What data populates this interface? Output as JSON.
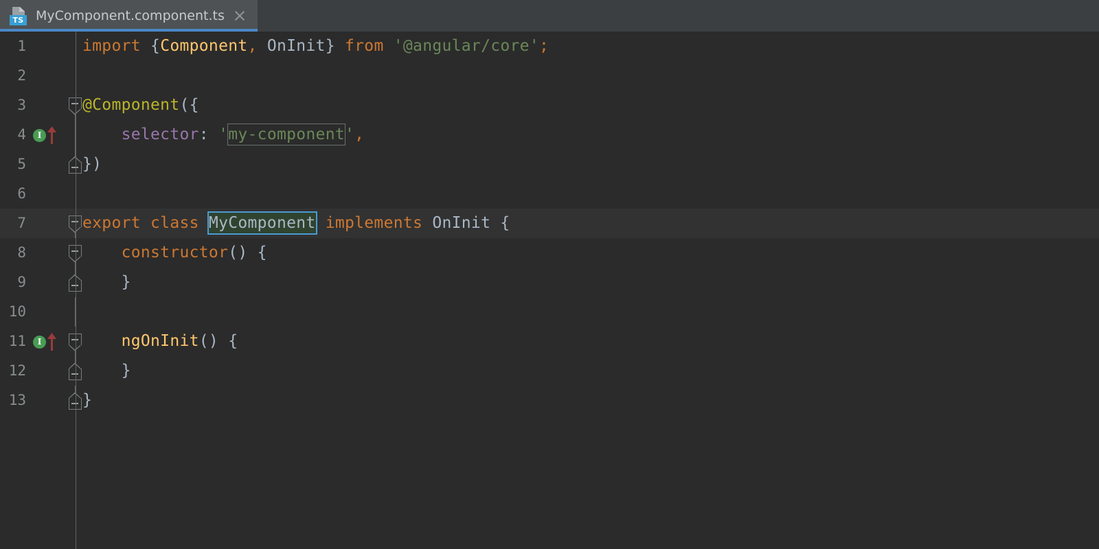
{
  "window": {
    "title": "MyComponent.component.ts"
  },
  "tab_bar": {
    "tabs": [
      {
        "label": "MyComponent.component.ts",
        "file_icon": "typescript-file-icon",
        "badge_text": "TS",
        "close_icon": "close-icon",
        "active": true
      }
    ]
  },
  "editor": {
    "language": "TypeScript",
    "current_line": 7,
    "gutter_markers": [
      {
        "line": 4,
        "icon": "implemented-method-icon",
        "glyph": "I",
        "color": "#499c54",
        "arrow": "overriding-arrow-icon",
        "arrow_color": "#9b3b3b"
      },
      {
        "line": 11,
        "icon": "implemented-method-icon",
        "glyph": "I",
        "color": "#499c54",
        "arrow": "overriding-arrow-icon",
        "arrow_color": "#9b3b3b"
      }
    ],
    "lines": [
      {
        "number": "1",
        "fold": "none",
        "tokens": [
          {
            "text": "import ",
            "cls": "t-kw"
          },
          {
            "text": "{",
            "cls": "t-punct"
          },
          {
            "text": "Component",
            "cls": "t-cls"
          },
          {
            "text": ", ",
            "cls": "t-kw"
          },
          {
            "text": "OnInit",
            "cls": "t-def"
          },
          {
            "text": "} ",
            "cls": "t-punct"
          },
          {
            "text": "from ",
            "cls": "t-kw"
          },
          {
            "text": "'@angular/core'",
            "cls": "t-str"
          },
          {
            "text": ";",
            "cls": "t-kw"
          }
        ]
      },
      {
        "number": "2",
        "fold": "none",
        "tokens": []
      },
      {
        "number": "3",
        "fold": "start",
        "tokens": [
          {
            "text": "@Component",
            "cls": "t-anno"
          },
          {
            "text": "({",
            "cls": "t-punct"
          }
        ]
      },
      {
        "number": "4",
        "fold": "line",
        "tokens": [
          {
            "text": "    ",
            "cls": "t-punct"
          },
          {
            "text": "selector",
            "cls": "t-prop"
          },
          {
            "text": ": ",
            "cls": "t-punct"
          },
          {
            "text": "'",
            "cls": "t-str"
          },
          {
            "text": "my-component",
            "cls": "t-str",
            "highlight": "search"
          },
          {
            "text": "'",
            "cls": "t-str"
          },
          {
            "text": ",",
            "cls": "t-kw"
          }
        ]
      },
      {
        "number": "5",
        "fold": "end",
        "tokens": [
          {
            "text": "})",
            "cls": "t-punct"
          }
        ]
      },
      {
        "number": "6",
        "fold": "none",
        "tokens": []
      },
      {
        "number": "7",
        "fold": "start",
        "current": true,
        "tokens": [
          {
            "text": "export class ",
            "cls": "t-kw"
          },
          {
            "text": "MyComponent",
            "cls": "t-def",
            "highlight": "rename"
          },
          {
            "text": " implements ",
            "cls": "t-kw"
          },
          {
            "text": "OnInit",
            "cls": "t-def"
          },
          {
            "text": " {",
            "cls": "t-punct"
          }
        ]
      },
      {
        "number": "8",
        "fold": "start",
        "tokens": [
          {
            "text": "    ",
            "cls": "t-punct"
          },
          {
            "text": "constructor",
            "cls": "t-kw"
          },
          {
            "text": "() {",
            "cls": "t-punct"
          }
        ]
      },
      {
        "number": "9",
        "fold": "end",
        "tokens": [
          {
            "text": "    }",
            "cls": "t-punct"
          }
        ]
      },
      {
        "number": "10",
        "fold": "line",
        "tokens": []
      },
      {
        "number": "11",
        "fold": "start",
        "tokens": [
          {
            "text": "    ",
            "cls": "t-punct"
          },
          {
            "text": "ngOnInit",
            "cls": "t-fn"
          },
          {
            "text": "() {",
            "cls": "t-punct"
          }
        ]
      },
      {
        "number": "12",
        "fold": "end",
        "tokens": [
          {
            "text": "    }",
            "cls": "t-punct"
          }
        ]
      },
      {
        "number": "13",
        "fold": "end",
        "tokens": [
          {
            "text": "}",
            "cls": "t-punct"
          }
        ]
      }
    ]
  },
  "colors": {
    "editor_background": "#2b2b2b",
    "current_line_background": "#323232",
    "tab_bar_background": "#3c3f41",
    "active_tab_background": "#4e5254",
    "active_tab_underline": "#4a88c7",
    "line_number": "#888e90",
    "keyword": "#cc7832",
    "string": "#6a8759",
    "class_name": "#ffc66d",
    "annotation": "#bbb529",
    "property": "#9876aa",
    "default_text": "#a9b7c6",
    "rename_box_border": "#4a9bd4",
    "rename_box_background": "#30432f",
    "search_box_border": "#6b6f70",
    "gutter_separator": "#606366"
  }
}
